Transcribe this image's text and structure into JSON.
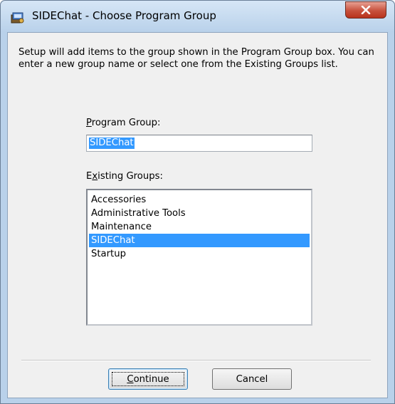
{
  "window": {
    "title": "SIDEChat - Choose Program Group",
    "close_label": "x"
  },
  "dialog": {
    "description": "Setup will add items to the group shown in the Program Group box. You can enter a new group name or select one from the Existing Groups list.",
    "program_group": {
      "label_mnemonic": "P",
      "label_rest": "rogram Group:",
      "value": "SIDEChat"
    },
    "existing_groups": {
      "label_prefix": "E",
      "label_mnemonic": "x",
      "label_rest": "isting Groups:",
      "items": [
        "Accessories",
        "Administrative Tools",
        "Maintenance",
        "SIDEChat",
        "Startup"
      ],
      "selected": "SIDEChat"
    },
    "buttons": {
      "continue_mnemonic": "C",
      "continue_rest": "ontinue",
      "cancel": "Cancel"
    }
  }
}
